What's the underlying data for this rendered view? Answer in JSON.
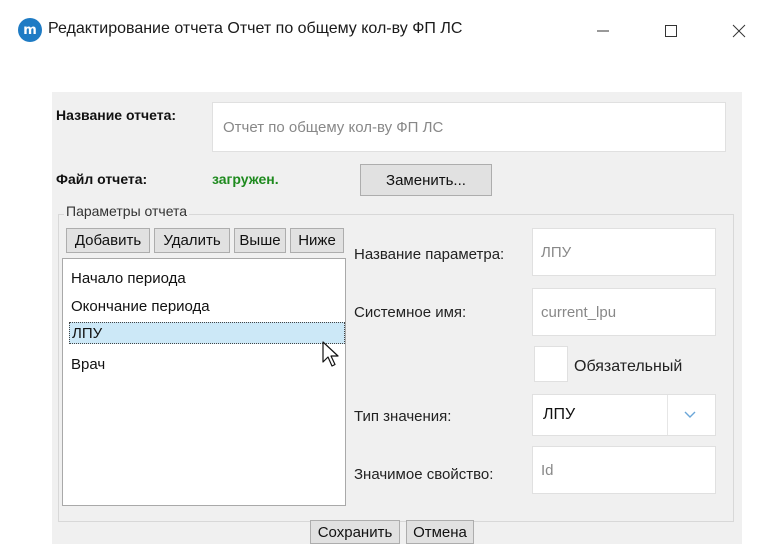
{
  "window": {
    "title": "Редактирование отчета Отчет по общему кол-ву ФП ЛС",
    "app_icon_glyph": "m",
    "icon_color": "#1e7bc4"
  },
  "report": {
    "name_label": "Название отчета:",
    "name_value": "Отчет по общему кол-ву ФП ЛС",
    "file_label": "Файл отчета:",
    "file_status": "загружен.",
    "file_status_color": "#1e8a1e",
    "replace_button": "Заменить..."
  },
  "params": {
    "group_title": "Параметры отчета",
    "toolbar": {
      "add": "Добавить",
      "delete": "Удалить",
      "up": "Выше",
      "down": "Ниже"
    },
    "items": [
      {
        "label": "Начало периода",
        "selected": false
      },
      {
        "label": "Окончание периода",
        "selected": false
      },
      {
        "label": "ЛПУ",
        "selected": true
      },
      {
        "label": "Врач",
        "selected": false
      }
    ],
    "detail": {
      "name_label": "Название параметра:",
      "name_value": "ЛПУ",
      "system_label": "Системное имя:",
      "system_value": "current_lpu",
      "required_label": "Обязательный",
      "required_checked": false,
      "type_label": "Тип значения:",
      "type_value": "ЛПУ",
      "property_label": "Значимое свойство:",
      "property_value": "Id"
    }
  },
  "footer": {
    "save": "Сохранить",
    "cancel": "Отмена"
  }
}
